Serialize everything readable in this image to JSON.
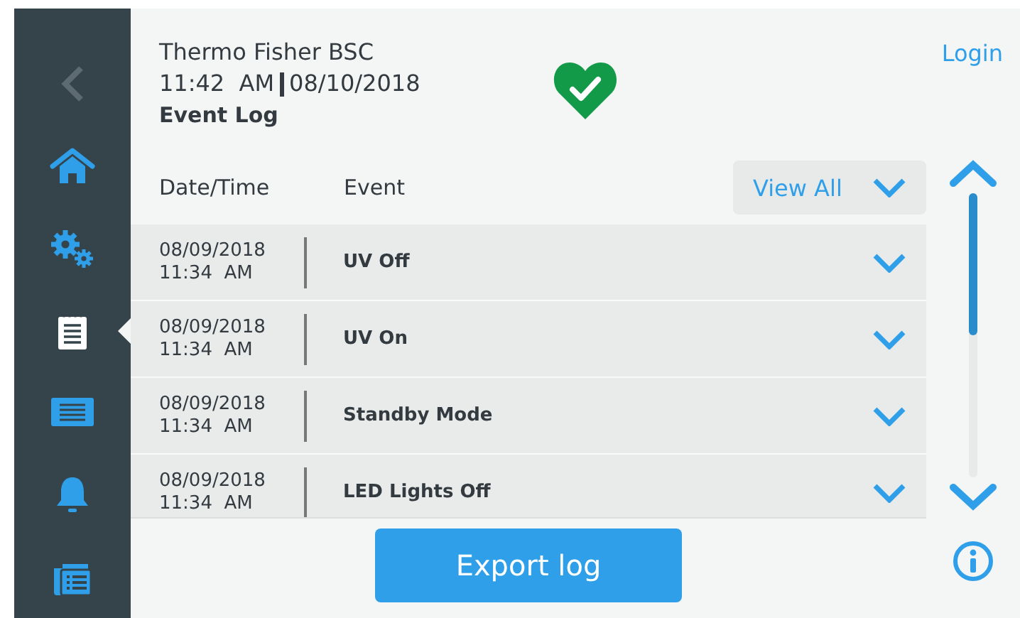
{
  "sidebar": {
    "items": [
      {
        "kind": "back",
        "selected": false
      },
      {
        "kind": "home",
        "selected": false
      },
      {
        "kind": "settings",
        "selected": false
      },
      {
        "kind": "log",
        "selected": true
      },
      {
        "kind": "display",
        "selected": false
      },
      {
        "kind": "alarm",
        "selected": false
      },
      {
        "kind": "schedule",
        "selected": false
      }
    ]
  },
  "header": {
    "title": "Thermo Fisher BSC",
    "time": "11:42  AM",
    "date": "08/10/2018",
    "page": "Event Log",
    "login": "Login"
  },
  "table": {
    "columns": [
      "Date/Time",
      "Event"
    ],
    "filter": "View All",
    "rows": [
      {
        "date": "08/09/2018",
        "time": "11:34  AM",
        "event": "UV Off"
      },
      {
        "date": "08/09/2018",
        "time": "11:34  AM",
        "event": "UV On"
      },
      {
        "date": "08/09/2018",
        "time": "11:34  AM",
        "event": "Standby Mode"
      },
      {
        "date": "08/09/2018",
        "time": "11:34  AM",
        "event": "LED Lights Off"
      }
    ]
  },
  "export_button": "Export log"
}
